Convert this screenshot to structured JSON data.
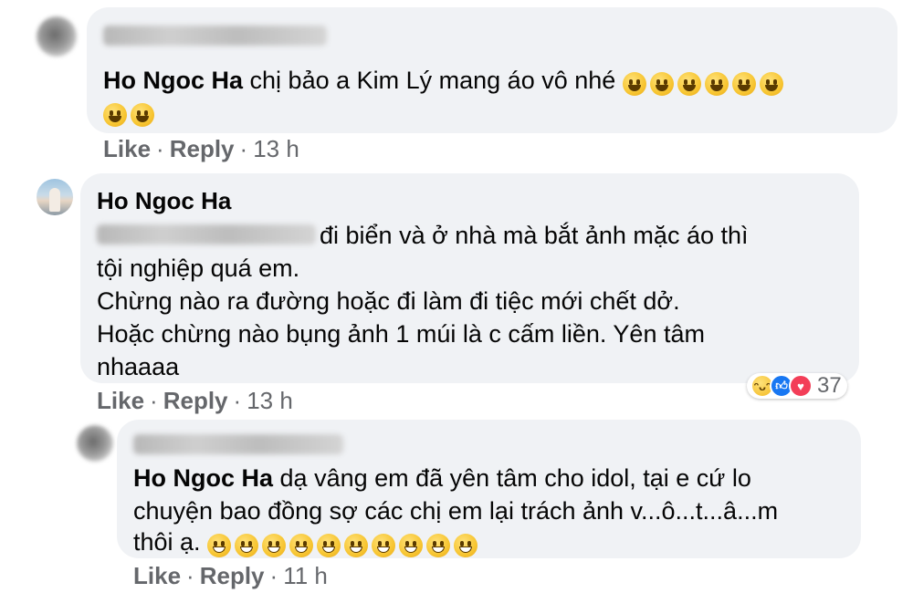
{
  "comments": [
    {
      "author_redacted": true,
      "mention": "Ho Ngoc Ha",
      "text": "chị bảo a Kim Lý mang áo vô nhé",
      "emoji_count": 8,
      "actions": {
        "like": "Like",
        "reply": "Reply"
      },
      "time": "13 h"
    },
    {
      "author": "Ho Ngoc Ha",
      "lines": [
        "đi biển và ở nhà mà bắt ảnh mặc áo thì",
        "tội nghiệp quá em.",
        "Chừng nào ra đường hoặc đi làm đi tiệc mới chết dở.",
        "Hoặc chừng nào bụng ảnh 1 múi là c cấm liền. Yên tâm",
        "nhaaaa"
      ],
      "reactions": {
        "icons": [
          "haha-icon",
          "like-icon",
          "love-icon"
        ],
        "count": "37"
      },
      "actions": {
        "like": "Like",
        "reply": "Reply"
      },
      "time": "13 h"
    },
    {
      "author_redacted": true,
      "mention": "Ho Ngoc Ha",
      "lines": [
        "dạ vâng em đã yên tâm cho idol, tại e cứ lo",
        "chuyện bao đồng sợ các chị em lại trách ảnh v...ô...t...â...m",
        "thôi ạ."
      ],
      "emoji_count": 10,
      "actions": {
        "like": "Like",
        "reply": "Reply"
      },
      "time": "11 h"
    }
  ],
  "separator": "·",
  "colors": {
    "bubble": "#f0f2f5",
    "meta": "#65676b",
    "text": "#050505"
  }
}
